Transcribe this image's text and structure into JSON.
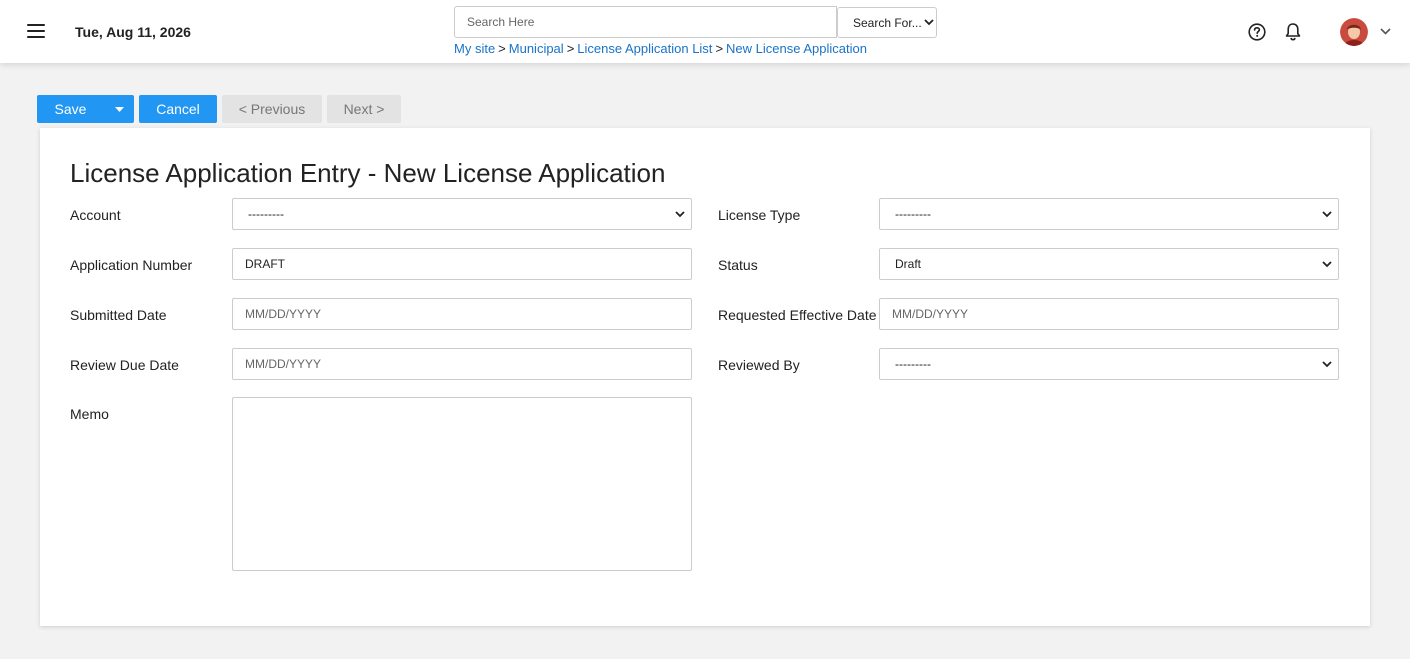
{
  "header": {
    "date": "Tue, Aug 11, 2026",
    "search_placeholder": "Search Here",
    "search_scope": "Search For...",
    "breadcrumb": [
      {
        "label": "My site"
      },
      {
        "label": "Municipal"
      },
      {
        "label": "License Application List"
      },
      {
        "label": "New License Application"
      }
    ],
    "breadcrumb_sep": ">"
  },
  "toolbar": {
    "save_label": "Save",
    "cancel_label": "Cancel",
    "previous_label": "< Previous",
    "next_label": "Next >"
  },
  "form": {
    "title": "License Application Entry - New License Application",
    "account": {
      "label": "Account",
      "value": "---------"
    },
    "license_type": {
      "label": "License Type",
      "value": "---------"
    },
    "application_number": {
      "label": "Application Number",
      "value": "DRAFT"
    },
    "status": {
      "label": "Status",
      "value": "Draft"
    },
    "submitted_date": {
      "label": "Submitted Date",
      "placeholder": "MM/DD/YYYY"
    },
    "requested_effective_date": {
      "label": "Requested Effective Date",
      "placeholder": "MM/DD/YYYY"
    },
    "review_due_date": {
      "label": "Review Due Date",
      "placeholder": "MM/DD/YYYY"
    },
    "reviewed_by": {
      "label": "Reviewed By",
      "value": "---------"
    },
    "memo": {
      "label": "Memo",
      "value": ""
    }
  },
  "colors": {
    "primary": "#2196f3",
    "link": "#1a73c8"
  }
}
